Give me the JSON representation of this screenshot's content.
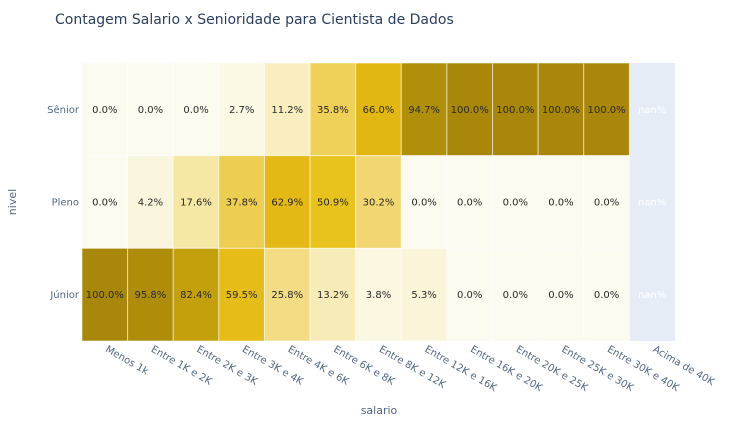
{
  "chart_data": {
    "type": "heatmap",
    "title": "Contagem Salario x Senioridade para Cientista de Dados",
    "xlabel": "salario",
    "ylabel": "nivel",
    "x_categories": [
      "Menos 1k",
      "Entre 1K e 2K",
      "Entre 2K e 3K",
      "Entre 3K e 4K",
      "Entre 4K e 6K",
      "Entre 6K e 8K",
      "Entre 8K e 12K",
      "Entre 12K e 16K",
      "Entre 16K e 20K",
      "Entre 20K e 25K",
      "Entre 25K e 30K",
      "Entre 30K e 40K",
      "Acima de 40K"
    ],
    "y_categories": [
      "Sênior",
      "Pleno",
      "Júnior"
    ],
    "values": [
      [
        0.0,
        0.0,
        0.0,
        2.7,
        11.2,
        35.8,
        66.0,
        94.7,
        100.0,
        100.0,
        100.0,
        100.0,
        null
      ],
      [
        0.0,
        4.2,
        17.6,
        37.8,
        62.9,
        50.9,
        30.2,
        0.0,
        0.0,
        0.0,
        0.0,
        0.0,
        null
      ],
      [
        100.0,
        95.8,
        82.4,
        59.5,
        25.8,
        13.2,
        3.8,
        5.3,
        0.0,
        0.0,
        0.0,
        0.0,
        null
      ]
    ],
    "labels": [
      [
        "0.0%",
        "0.0%",
        "0.0%",
        "2.7%",
        "11.2%",
        "35.8%",
        "66.0%",
        "94.7%",
        "100.0%",
        "100.0%",
        "100.0%",
        "100.0%",
        "nan%"
      ],
      [
        "0.0%",
        "4.2%",
        "17.6%",
        "37.8%",
        "62.9%",
        "50.9%",
        "30.2%",
        "0.0%",
        "0.0%",
        "0.0%",
        "0.0%",
        "0.0%",
        "nan%"
      ],
      [
        "100.0%",
        "95.8%",
        "82.4%",
        "59.5%",
        "25.8%",
        "13.2%",
        "3.8%",
        "5.3%",
        "0.0%",
        "0.0%",
        "0.0%",
        "0.0%",
        "nan%"
      ]
    ],
    "colorscale": [
      "#fcfbf0",
      "#f6e8a8",
      "#f0d264",
      "#e9c41d",
      "#e2b614",
      "#c2a00b",
      "#a8870a"
    ],
    "background": "#e5ecf6",
    "grid": true,
    "legend": "none"
  }
}
